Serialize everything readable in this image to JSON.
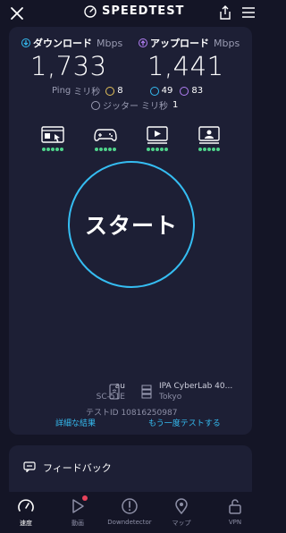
{
  "header": {
    "brand_title": "SPEEDTEST",
    "icons": [
      "close-icon",
      "speedometer-icon",
      "share-icon",
      "menu-icon"
    ]
  },
  "results": {
    "download": {
      "label": "ダウンロード",
      "unit": "Mbps",
      "value": "1,733",
      "color": "#35bdf2"
    },
    "upload": {
      "label": "アップロード",
      "unit": "Mbps",
      "value": "1,441",
      "color": "#b27ff5"
    },
    "ping": {
      "label": "Ping",
      "unit": "ミリ秒",
      "idle": "8",
      "download": "49",
      "upload": "83"
    },
    "jitter": {
      "label": "ジッター",
      "unit": "ミリ秒",
      "value": "1"
    }
  },
  "apps": {
    "icons": [
      "web-browsing-icon",
      "gaming-icon",
      "video-streaming-icon",
      "video-chat-icon"
    ],
    "rating_dots": 5,
    "dot_color": "#4fd38a"
  },
  "start": {
    "label": "スタート",
    "ring_color": "#35bdf2"
  },
  "connection": {
    "isp": "au",
    "device": "SC-51E",
    "server_name": "IPA CyberLab 40...",
    "server_city": "Tokyo",
    "test_id": "テストID 10816250987",
    "details_link": "詳細な結果",
    "retest_link": "もう一度テストする"
  },
  "feedback": {
    "label": "フィードバック"
  },
  "nav": {
    "tabs": [
      {
        "label": "速度",
        "icon": "speedometer-icon",
        "active": true
      },
      {
        "label": "動画",
        "icon": "play-icon",
        "active": false
      },
      {
        "label": "Downdetector",
        "icon": "alert-icon",
        "active": false
      },
      {
        "label": "マップ",
        "icon": "map-pin-icon",
        "active": false
      },
      {
        "label": "VPN",
        "icon": "lock-icon",
        "active": false
      }
    ]
  }
}
